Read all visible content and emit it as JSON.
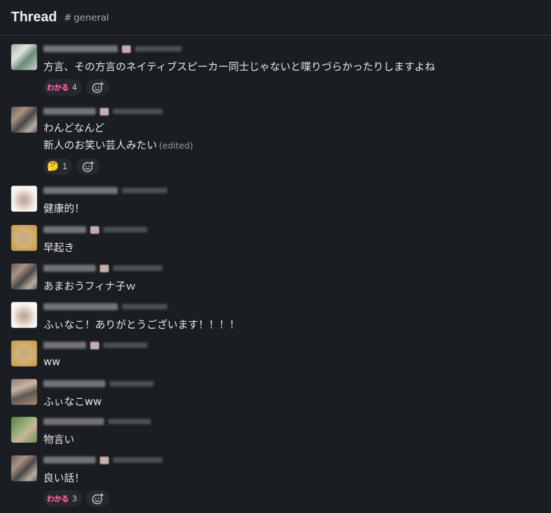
{
  "header": {
    "title": "Thread",
    "channel_hash": "#",
    "channel": "general"
  },
  "messages": [
    {
      "text": "方言、その方言のネイティブスピーカー同士じゃないと喋りづらかったりしますよね",
      "reactions": [
        {
          "emoji": "わかる",
          "count": "4"
        }
      ]
    },
    {
      "text": "わんどなんど",
      "text2": "新人のお笑い芸人みたい",
      "edited": "(edited)",
      "reactions": [
        {
          "emoji": "🤔",
          "count": "1"
        }
      ]
    },
    {
      "text": "健康的！"
    },
    {
      "text": "早起き"
    },
    {
      "text": "あまおうフィナ子ｗ"
    },
    {
      "text": "ふぃなこ！ありがとうございます！！！！"
    },
    {
      "text": "ww"
    },
    {
      "text": "ふぃなこww"
    },
    {
      "text": "物言い"
    },
    {
      "text": "良い話！",
      "reactions": [
        {
          "emoji": "わかる",
          "count": "3"
        }
      ]
    }
  ],
  "icons": {
    "add_reaction": "add-reaction-icon",
    "channel": "hash-icon"
  },
  "colors": {
    "background": "#1a1d21",
    "text": "#e8e8e8",
    "reaction_bg": "#26292d",
    "wakaru": "#ff77b4"
  }
}
